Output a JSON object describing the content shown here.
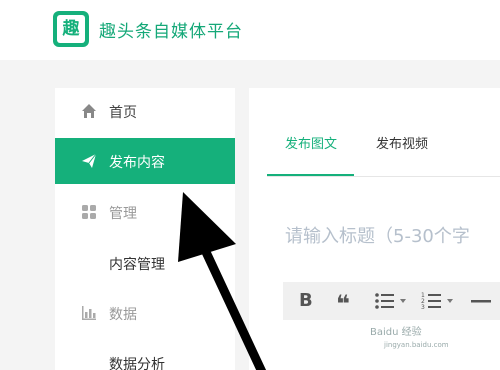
{
  "header": {
    "logo_char": "趣",
    "title": "趣头条自媒体平台"
  },
  "sidebar": {
    "items": [
      {
        "label": "首页",
        "icon": "home-icon"
      },
      {
        "label": "发布内容",
        "icon": "send-icon",
        "active": true
      },
      {
        "label": "管理",
        "icon": "grid-icon"
      },
      {
        "label": "内容管理"
      },
      {
        "label": "数据",
        "icon": "bar-chart-icon"
      },
      {
        "label": "数据分析"
      }
    ]
  },
  "main": {
    "tabs": [
      {
        "label": "发布图文",
        "active": true
      },
      {
        "label": "发布视频"
      }
    ],
    "title_placeholder": "请输入标题（5-30个字"
  },
  "editor_toolbar": {
    "bold": "B",
    "quote": "❝"
  },
  "watermark": {
    "text": "Baidu 经验",
    "url": "jingyan.baidu.com"
  },
  "colors": {
    "accent": "#15b07b",
    "placeholder": "#b6c0cc"
  }
}
